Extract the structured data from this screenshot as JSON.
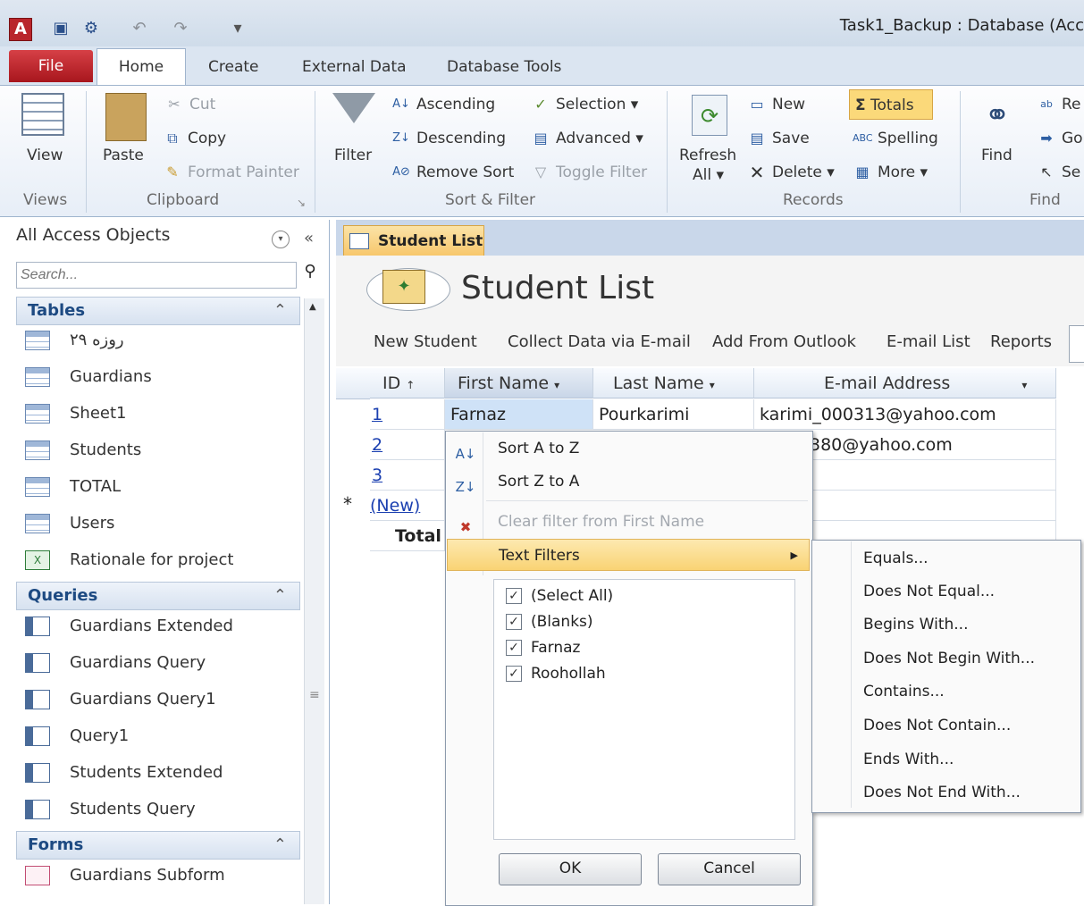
{
  "window": {
    "app_title": "Task1_Backup : Database (Acc"
  },
  "tabs": {
    "file": "File",
    "home": "Home",
    "create": "Create",
    "external": "External Data",
    "dbtools": "Database Tools"
  },
  "ribbon": {
    "views": {
      "view": "View",
      "label": "Views"
    },
    "clipboard": {
      "paste": "Paste",
      "cut": "Cut",
      "copy": "Copy",
      "format_painter": "Format Painter",
      "label": "Clipboard"
    },
    "sort_filter": {
      "filter": "Filter",
      "ascending": "Ascending",
      "descending": "Descending",
      "remove_sort": "Remove Sort",
      "selection": "Selection",
      "advanced": "Advanced",
      "toggle_filter": "Toggle Filter",
      "label": "Sort & Filter"
    },
    "records": {
      "refresh_line1": "Refresh",
      "refresh_line2": "All",
      "new": "New",
      "save": "Save",
      "delete": "Delete",
      "totals": "Totals",
      "spelling": "Spelling",
      "more": "More",
      "label": "Records"
    },
    "find": {
      "find": "Find",
      "replace": "Re",
      "goto": "Go",
      "select": "Se",
      "label": "Find"
    }
  },
  "nav": {
    "header": "All Access Objects",
    "search_placeholder": "Search...",
    "sections": {
      "tables": {
        "title": "Tables",
        "items": [
          "روزه ۲۹",
          "Guardians",
          "Sheet1",
          "Students",
          "TOTAL",
          "Users",
          "Rationale for project"
        ]
      },
      "queries": {
        "title": "Queries",
        "items": [
          "Guardians Extended",
          "Guardians Query",
          "Guardians Query1",
          "Query1",
          "Students Extended",
          "Students Query"
        ]
      },
      "forms": {
        "title": "Forms",
        "items": [
          "Guardians Subform"
        ]
      }
    }
  },
  "document": {
    "tab": "Student List",
    "title": "Student List",
    "links": [
      "New Student",
      "Collect Data via E-mail",
      "Add From Outlook",
      "E-mail List",
      "Reports"
    ],
    "columns": {
      "id": "ID",
      "first": "First Name",
      "last": "Last Name",
      "email": "E-mail Address"
    },
    "rows": [
      {
        "id": "1",
        "first": "Farnaz",
        "last": "Pourkarimi",
        "email": "karimi_000313@yahoo.com"
      },
      {
        "id": "2",
        "first": "",
        "last": "",
        "email": "380@yahoo.com"
      },
      {
        "id": "3",
        "first": "",
        "last": "",
        "email": ""
      }
    ],
    "new_row": "(New)",
    "new_marker": "*",
    "total_label": "Total"
  },
  "filter_menu": {
    "sort_az": "Sort A to Z",
    "sort_za": "Sort Z to A",
    "clear_filter": "Clear filter from First Name",
    "text_filters": "Text Filters",
    "checklist": [
      "(Select All)",
      "(Blanks)",
      "Farnaz",
      "Roohollah"
    ],
    "ok": "OK",
    "cancel": "Cancel"
  },
  "text_filters_menu": [
    "Equals...",
    "Does Not Equal...",
    "Begins With...",
    "Does Not Begin With...",
    "Contains...",
    "Does Not Contain...",
    "Ends With...",
    "Does Not End With..."
  ],
  "colors": {
    "file_tab": "#b8232b",
    "highlight": "#fbd97a",
    "link": "#1a3fb0",
    "section_title": "#1d4a82"
  }
}
